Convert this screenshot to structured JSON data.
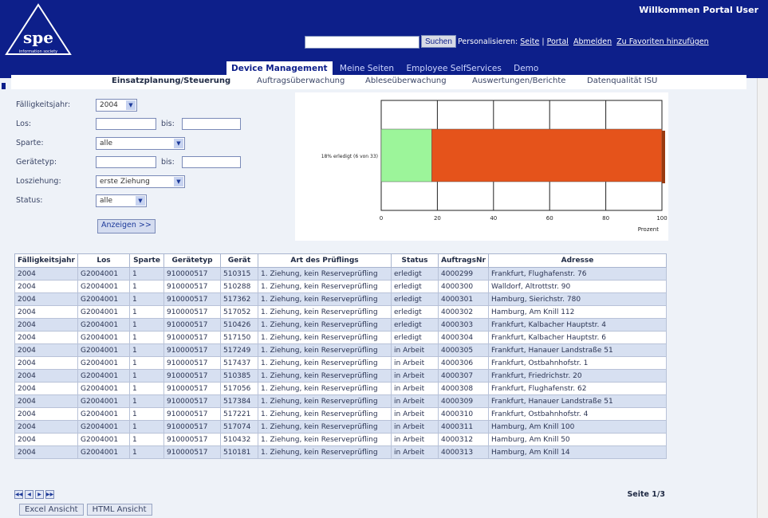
{
  "header": {
    "logo_text": "spe",
    "logo_tagline": "information society",
    "welcome": "Willkommen Portal User",
    "search_button": "Suchen",
    "search_value": "",
    "links_prefix": "Personalisieren:",
    "link_seite": "Seite",
    "link_portal": "Portal",
    "link_abmelden": "Abmelden",
    "link_favoriten": "Zu Favoriten hinzufügen"
  },
  "main_tabs": [
    "Device Management",
    "Meine Seiten",
    "Employee SelfServices",
    "Demo"
  ],
  "sub_nav": [
    "Einsatzplanung/Steuerung",
    "Auftragsüberwachung",
    "Ableseüberwachung",
    "Auswertungen/Berichte",
    "Datenqualität ISU"
  ],
  "form": {
    "faelligkeitsjahr_label": "Fälligkeitsjahr:",
    "faelligkeitsjahr_value": "2004",
    "los_label": "Los:",
    "bis": "bis:",
    "sparte_label": "Sparte:",
    "sparte_value": "alle",
    "geraetetyp_label": "Gerätetyp:",
    "losziehung_label": "Losziehung:",
    "losziehung_value": "erste Ziehung",
    "status_label": "Status:",
    "status_value": "alle",
    "anzeigen": "Anzeigen >>"
  },
  "chart_data": {
    "type": "bar",
    "orientation": "horizontal",
    "stacked": true,
    "categories": [
      "18% erledigt (6 von 33)"
    ],
    "series": [
      {
        "values": [
          18
        ],
        "color": "#9cf59a"
      },
      {
        "values": [
          82
        ],
        "color": "#e5531b"
      }
    ],
    "xlim": [
      0,
      100
    ],
    "xticks": [
      0,
      20,
      40,
      60,
      80,
      100
    ],
    "xlabel": "Prozent",
    "grid": true
  },
  "table": {
    "columns": [
      "Fälligkeitsjahr",
      "Los",
      "Sparte",
      "Gerätetyp",
      "Gerät",
      "Art des Prüflings",
      "Status",
      "AuftragsNr",
      "Adresse"
    ],
    "rows": [
      [
        "2004",
        "G2004001",
        "1",
        "910000517",
        "510315",
        "1. Ziehung, kein Reserveprüfling",
        "erledigt",
        "4000299",
        "Frankfurt, Flughafenstr. 76"
      ],
      [
        "2004",
        "G2004001",
        "1",
        "910000517",
        "510288",
        "1. Ziehung, kein Reserveprüfling",
        "erledigt",
        "4000300",
        "Walldorf, Altrottstr. 90"
      ],
      [
        "2004",
        "G2004001",
        "1",
        "910000517",
        "517362",
        "1. Ziehung, kein Reserveprüfling",
        "erledigt",
        "4000301",
        "Hamburg, Sierichstr. 780"
      ],
      [
        "2004",
        "G2004001",
        "1",
        "910000517",
        "517052",
        "1. Ziehung, kein Reserveprüfling",
        "erledigt",
        "4000302",
        "Hamburg, Am Knill 112"
      ],
      [
        "2004",
        "G2004001",
        "1",
        "910000517",
        "510426",
        "1. Ziehung, kein Reserveprüfling",
        "erledigt",
        "4000303",
        "Frankfurt, Kalbacher Hauptstr. 4"
      ],
      [
        "2004",
        "G2004001",
        "1",
        "910000517",
        "517150",
        "1. Ziehung, kein Reserveprüfling",
        "erledigt",
        "4000304",
        "Frankfurt, Kalbacher Hauptstr. 6"
      ],
      [
        "2004",
        "G2004001",
        "1",
        "910000517",
        "517249",
        "1. Ziehung, kein Reserveprüfling",
        "in Arbeit",
        "4000305",
        "Frankfurt, Hanauer Landstraße 51"
      ],
      [
        "2004",
        "G2004001",
        "1",
        "910000517",
        "517437",
        "1. Ziehung, kein Reserveprüfling",
        "in Arbeit",
        "4000306",
        "Frankfurt, Ostbahnhofstr. 1"
      ],
      [
        "2004",
        "G2004001",
        "1",
        "910000517",
        "510385",
        "1. Ziehung, kein Reserveprüfling",
        "in Arbeit",
        "4000307",
        "Frankfurt, Friedrichstr. 20"
      ],
      [
        "2004",
        "G2004001",
        "1",
        "910000517",
        "517056",
        "1. Ziehung, kein Reserveprüfling",
        "in Arbeit",
        "4000308",
        "Frankfurt, Flughafenstr. 62"
      ],
      [
        "2004",
        "G2004001",
        "1",
        "910000517",
        "517384",
        "1. Ziehung, kein Reserveprüfling",
        "in Arbeit",
        "4000309",
        "Frankfurt, Hanauer Landstraße 51"
      ],
      [
        "2004",
        "G2004001",
        "1",
        "910000517",
        "517221",
        "1. Ziehung, kein Reserveprüfling",
        "in Arbeit",
        "4000310",
        "Frankfurt, Ostbahnhofstr. 4"
      ],
      [
        "2004",
        "G2004001",
        "1",
        "910000517",
        "517074",
        "1. Ziehung, kein Reserveprüfling",
        "in Arbeit",
        "4000311",
        "Hamburg, Am Knill 100"
      ],
      [
        "2004",
        "G2004001",
        "1",
        "910000517",
        "510432",
        "1. Ziehung, kein Reserveprüfling",
        "in Arbeit",
        "4000312",
        "Hamburg, Am Knill 50"
      ],
      [
        "2004",
        "G2004001",
        "1",
        "910000517",
        "510181",
        "1. Ziehung, kein Reserveprüfling",
        "in Arbeit",
        "4000313",
        "Hamburg, Am Knill 14"
      ]
    ]
  },
  "pager": {
    "page_label": "Seite 1/3"
  },
  "bottom_tabs": [
    "Excel Ansicht",
    "HTML Ansicht"
  ],
  "colors": {
    "header_bg": "#0d1f8a",
    "row_alt": "#d7e0f1",
    "bar_done": "#9cf59a",
    "bar_open": "#e5531b"
  }
}
